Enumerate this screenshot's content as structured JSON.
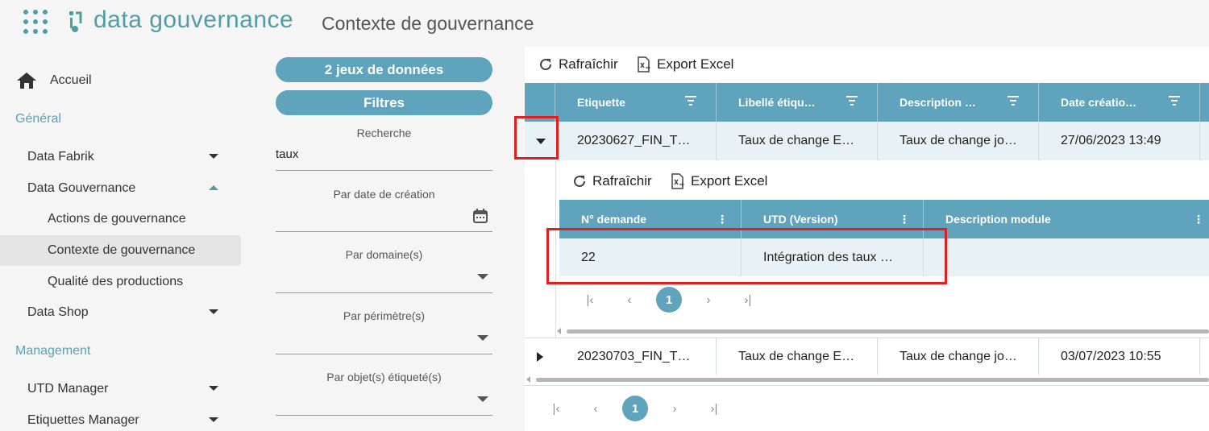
{
  "header": {
    "logo_text": "data gouvernance",
    "page_title": "Contexte de gouvernance",
    "colors": {
      "brand": "#4f9ea4",
      "accent": "#5fa3bd",
      "highlight": "#e02020"
    }
  },
  "sidebar": {
    "home_label": "Accueil",
    "section_general": "Général",
    "data_fabrik": "Data Fabrik",
    "data_gouvernance": "Data Gouvernance",
    "actions": "Actions de gouvernance",
    "contexte": "Contexte de gouvernance",
    "qualite": "Qualité des productions",
    "data_shop": "Data Shop",
    "section_management": "Management",
    "utd_manager": "UTD Manager",
    "etiquettes_manager": "Etiquettes Manager"
  },
  "filters": {
    "datasets_button": "2 jeux de données",
    "filters_button": "Filtres",
    "search_label": "Recherche",
    "search_value": "taux",
    "date_label": "Par date de création",
    "domain_label": "Par domaine(s)",
    "perimeter_label": "Par périmètre(s)",
    "object_label": "Par objet(s) étiqueté(s)"
  },
  "grid": {
    "refresh_label": "Rafraîchir",
    "export_label": "Export Excel",
    "columns": [
      "Etiquette",
      "Libellé étiqu…",
      "Description …",
      "Date créatio…"
    ],
    "rows": [
      [
        "20230627_FIN_T…",
        "Taux de change E…",
        "Taux de change jo…",
        "27/06/2023 13:49"
      ],
      [
        "20230703_FIN_T…",
        "Taux de change E…",
        "Taux de change jo…",
        "03/07/2023 10:55"
      ]
    ],
    "page": "1"
  },
  "subgrid": {
    "refresh_label": "Rafraîchir",
    "export_label": "Export Excel",
    "columns": [
      "N° demande",
      "UTD (Version)",
      "Description module"
    ],
    "row": [
      "22",
      "Intégration des taux …",
      ""
    ],
    "page": "1"
  }
}
